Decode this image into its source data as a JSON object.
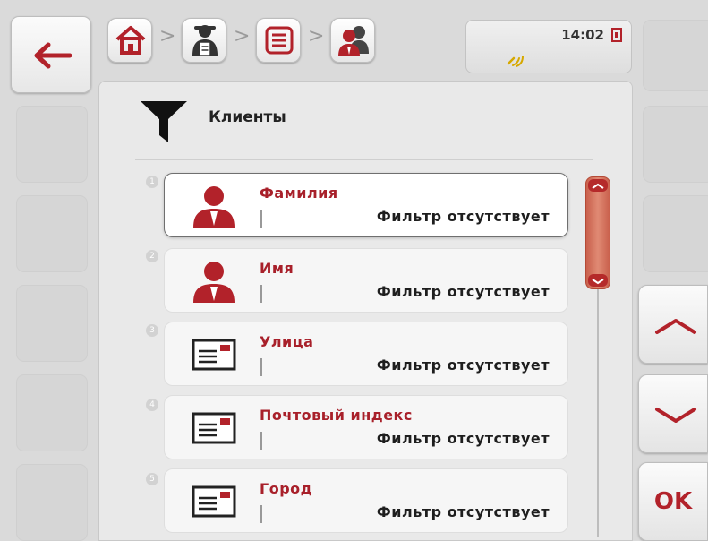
{
  "status": {
    "time": "14:02"
  },
  "breadcrumbs": [
    {
      "icon": "home-icon"
    },
    {
      "icon": "operator-icon"
    },
    {
      "icon": "list-menu-icon"
    },
    {
      "icon": "customers-icon"
    }
  ],
  "breadcrumb_separator": ">",
  "title": "Клиенты",
  "rows": [
    {
      "num": "1",
      "label": "Фамилия",
      "value": "Фильтр отсутствует",
      "icon": "person-icon",
      "selected": true
    },
    {
      "num": "2",
      "label": "Имя",
      "value": "Фильтр отсутствует",
      "icon": "person-icon",
      "selected": false
    },
    {
      "num": "3",
      "label": "Улица",
      "value": "Фильтр отсутствует",
      "icon": "address-card-icon",
      "selected": false
    },
    {
      "num": "4",
      "label": "Почтовый индекс",
      "value": "Фильтр отсутствует",
      "icon": "address-card-icon",
      "selected": false
    },
    {
      "num": "5",
      "label": "Город",
      "value": "Фильтр отсутствует",
      "icon": "address-card-icon",
      "selected": false
    }
  ],
  "buttons": {
    "ok_label": "OK"
  },
  "colors": {
    "accent": "#b2222a",
    "label": "#a8202a",
    "scroll": "#d8735e"
  }
}
